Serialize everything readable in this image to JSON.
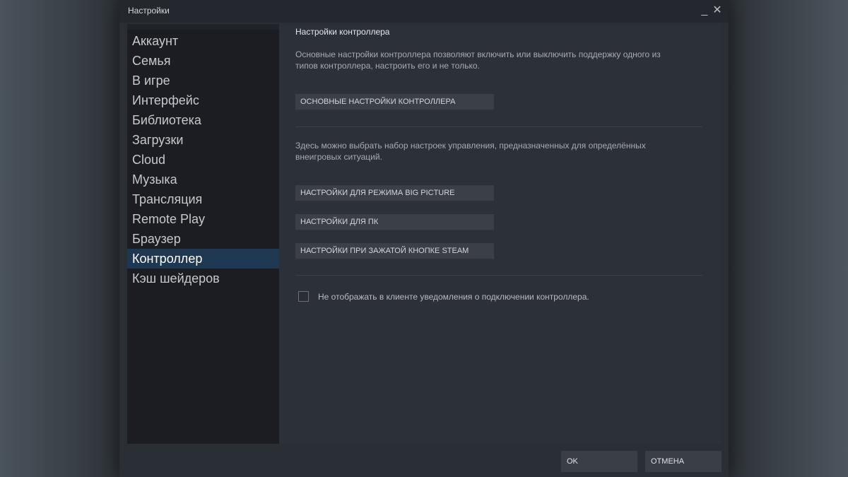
{
  "window": {
    "title": "Настройки",
    "minimize_glyph": "_",
    "close_glyph": "✕"
  },
  "sidebar": {
    "items": [
      {
        "label": "Аккаунт",
        "active": false
      },
      {
        "label": "Семья",
        "active": false
      },
      {
        "label": "В игре",
        "active": false
      },
      {
        "label": "Интерфейс",
        "active": false
      },
      {
        "label": "Библиотека",
        "active": false
      },
      {
        "label": "Загрузки",
        "active": false
      },
      {
        "label": "Cloud",
        "active": false
      },
      {
        "label": "Музыка",
        "active": false
      },
      {
        "label": "Трансляция",
        "active": false
      },
      {
        "label": "Remote Play",
        "active": false
      },
      {
        "label": "Браузер",
        "active": false
      },
      {
        "label": "Контроллер",
        "active": true
      },
      {
        "label": "Кэш шейдеров",
        "active": false
      }
    ]
  },
  "main": {
    "section_title": "Настройки контроллера",
    "desc_basic_line1": "Основные настройки контроллера позволяют включить или выключить поддержку одного из",
    "desc_basic_line2": "типов контроллера, настроить его и не только.",
    "basic_settings_button": "ОСНОВНЫЕ НАСТРОЙКИ КОНТРОЛЛЕРА",
    "desc_configs_line1": "Здесь можно выбрать набор настроек управления, предназначенных для определённых",
    "desc_configs_line2": "внеигровых ситуаций.",
    "big_picture_button": "НАСТРОЙКИ ДЛЯ РЕЖИМА BIG PICTURE",
    "pc_button": "НАСТРОЙКИ ДЛЯ ПК",
    "steam_button": "НАСТРОЙКИ ПРИ ЗАЖАТОЙ КНОПКЕ STEAM",
    "checkbox_label": "Не отображать в клиенте уведомления о подключении контроллера.",
    "checkbox_checked": false
  },
  "footer": {
    "ok_label": "OK",
    "cancel_label": "ОТМЕНА"
  },
  "colors": {
    "accent_active": "#1f3851",
    "window_bg": "#2a2e35",
    "sidebar_bg": "#1b1d22",
    "button_bg": "#3b3f47"
  }
}
